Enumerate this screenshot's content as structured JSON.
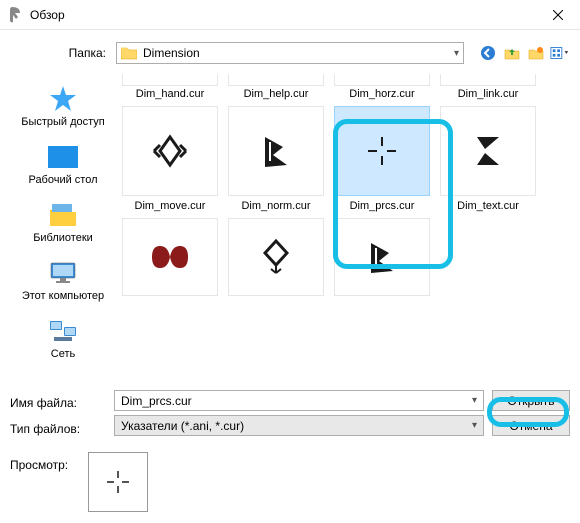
{
  "window": {
    "title": "Обзор"
  },
  "folder": {
    "label": "Папка:",
    "value": "Dimension"
  },
  "sidebar": {
    "items": [
      {
        "label": "Быстрый доступ"
      },
      {
        "label": "Рабочий стол"
      },
      {
        "label": "Библиотеки"
      },
      {
        "label": "Этот компьютер"
      },
      {
        "label": "Сеть"
      }
    ]
  },
  "files": {
    "row0": [
      {
        "name": "Dim_hand.cur"
      },
      {
        "name": "Dim_help.cur"
      },
      {
        "name": "Dim_horz.cur"
      },
      {
        "name": "Dim_link.cur"
      }
    ],
    "row1": [
      {
        "name": "Dim_move.cur"
      },
      {
        "name": "Dim_norm.cur"
      },
      {
        "name": "Dim_prcs.cur",
        "selected": true
      },
      {
        "name": "Dim_text.cur"
      }
    ],
    "row2": [
      {
        "name": ""
      },
      {
        "name": ""
      },
      {
        "name": ""
      }
    ]
  },
  "form": {
    "filename_label": "Имя файла:",
    "filename_value": "Dim_prcs.cur",
    "filetype_label": "Тип файлов:",
    "filetype_value": "Указатели (*.ani, *.cur)",
    "open": "Открыть",
    "cancel": "Отмена"
  },
  "preview": {
    "label": "Просмотр:"
  }
}
